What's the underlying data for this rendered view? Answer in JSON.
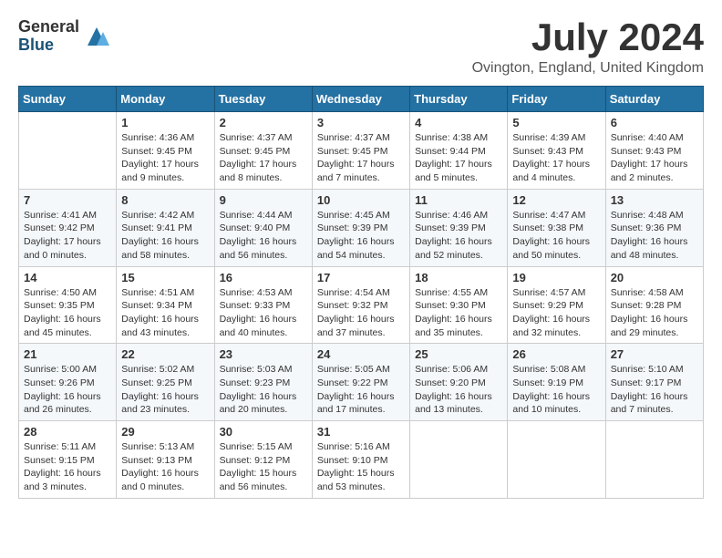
{
  "logo": {
    "general": "General",
    "blue": "Blue"
  },
  "title": "July 2024",
  "location": "Ovington, England, United Kingdom",
  "days_of_week": [
    "Sunday",
    "Monday",
    "Tuesday",
    "Wednesday",
    "Thursday",
    "Friday",
    "Saturday"
  ],
  "weeks": [
    [
      {
        "day": "",
        "info": ""
      },
      {
        "day": "1",
        "info": "Sunrise: 4:36 AM\nSunset: 9:45 PM\nDaylight: 17 hours\nand 9 minutes."
      },
      {
        "day": "2",
        "info": "Sunrise: 4:37 AM\nSunset: 9:45 PM\nDaylight: 17 hours\nand 8 minutes."
      },
      {
        "day": "3",
        "info": "Sunrise: 4:37 AM\nSunset: 9:45 PM\nDaylight: 17 hours\nand 7 minutes."
      },
      {
        "day": "4",
        "info": "Sunrise: 4:38 AM\nSunset: 9:44 PM\nDaylight: 17 hours\nand 5 minutes."
      },
      {
        "day": "5",
        "info": "Sunrise: 4:39 AM\nSunset: 9:43 PM\nDaylight: 17 hours\nand 4 minutes."
      },
      {
        "day": "6",
        "info": "Sunrise: 4:40 AM\nSunset: 9:43 PM\nDaylight: 17 hours\nand 2 minutes."
      }
    ],
    [
      {
        "day": "7",
        "info": "Sunrise: 4:41 AM\nSunset: 9:42 PM\nDaylight: 17 hours\nand 0 minutes."
      },
      {
        "day": "8",
        "info": "Sunrise: 4:42 AM\nSunset: 9:41 PM\nDaylight: 16 hours\nand 58 minutes."
      },
      {
        "day": "9",
        "info": "Sunrise: 4:44 AM\nSunset: 9:40 PM\nDaylight: 16 hours\nand 56 minutes."
      },
      {
        "day": "10",
        "info": "Sunrise: 4:45 AM\nSunset: 9:39 PM\nDaylight: 16 hours\nand 54 minutes."
      },
      {
        "day": "11",
        "info": "Sunrise: 4:46 AM\nSunset: 9:39 PM\nDaylight: 16 hours\nand 52 minutes."
      },
      {
        "day": "12",
        "info": "Sunrise: 4:47 AM\nSunset: 9:38 PM\nDaylight: 16 hours\nand 50 minutes."
      },
      {
        "day": "13",
        "info": "Sunrise: 4:48 AM\nSunset: 9:36 PM\nDaylight: 16 hours\nand 48 minutes."
      }
    ],
    [
      {
        "day": "14",
        "info": "Sunrise: 4:50 AM\nSunset: 9:35 PM\nDaylight: 16 hours\nand 45 minutes."
      },
      {
        "day": "15",
        "info": "Sunrise: 4:51 AM\nSunset: 9:34 PM\nDaylight: 16 hours\nand 43 minutes."
      },
      {
        "day": "16",
        "info": "Sunrise: 4:53 AM\nSunset: 9:33 PM\nDaylight: 16 hours\nand 40 minutes."
      },
      {
        "day": "17",
        "info": "Sunrise: 4:54 AM\nSunset: 9:32 PM\nDaylight: 16 hours\nand 37 minutes."
      },
      {
        "day": "18",
        "info": "Sunrise: 4:55 AM\nSunset: 9:30 PM\nDaylight: 16 hours\nand 35 minutes."
      },
      {
        "day": "19",
        "info": "Sunrise: 4:57 AM\nSunset: 9:29 PM\nDaylight: 16 hours\nand 32 minutes."
      },
      {
        "day": "20",
        "info": "Sunrise: 4:58 AM\nSunset: 9:28 PM\nDaylight: 16 hours\nand 29 minutes."
      }
    ],
    [
      {
        "day": "21",
        "info": "Sunrise: 5:00 AM\nSunset: 9:26 PM\nDaylight: 16 hours\nand 26 minutes."
      },
      {
        "day": "22",
        "info": "Sunrise: 5:02 AM\nSunset: 9:25 PM\nDaylight: 16 hours\nand 23 minutes."
      },
      {
        "day": "23",
        "info": "Sunrise: 5:03 AM\nSunset: 9:23 PM\nDaylight: 16 hours\nand 20 minutes."
      },
      {
        "day": "24",
        "info": "Sunrise: 5:05 AM\nSunset: 9:22 PM\nDaylight: 16 hours\nand 17 minutes."
      },
      {
        "day": "25",
        "info": "Sunrise: 5:06 AM\nSunset: 9:20 PM\nDaylight: 16 hours\nand 13 minutes."
      },
      {
        "day": "26",
        "info": "Sunrise: 5:08 AM\nSunset: 9:19 PM\nDaylight: 16 hours\nand 10 minutes."
      },
      {
        "day": "27",
        "info": "Sunrise: 5:10 AM\nSunset: 9:17 PM\nDaylight: 16 hours\nand 7 minutes."
      }
    ],
    [
      {
        "day": "28",
        "info": "Sunrise: 5:11 AM\nSunset: 9:15 PM\nDaylight: 16 hours\nand 3 minutes."
      },
      {
        "day": "29",
        "info": "Sunrise: 5:13 AM\nSunset: 9:13 PM\nDaylight: 16 hours\nand 0 minutes."
      },
      {
        "day": "30",
        "info": "Sunrise: 5:15 AM\nSunset: 9:12 PM\nDaylight: 15 hours\nand 56 minutes."
      },
      {
        "day": "31",
        "info": "Sunrise: 5:16 AM\nSunset: 9:10 PM\nDaylight: 15 hours\nand 53 minutes."
      },
      {
        "day": "",
        "info": ""
      },
      {
        "day": "",
        "info": ""
      },
      {
        "day": "",
        "info": ""
      }
    ]
  ]
}
